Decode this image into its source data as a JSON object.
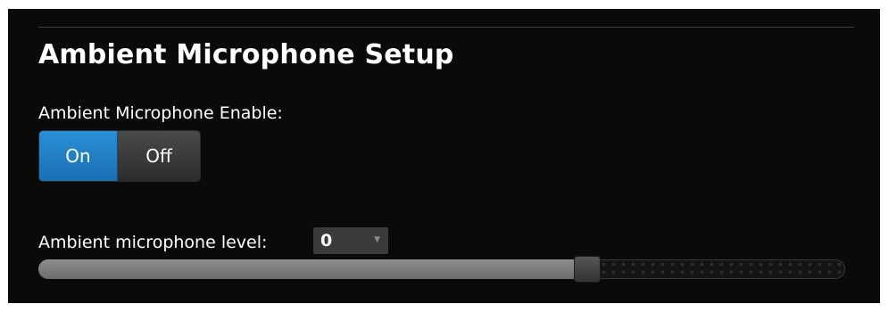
{
  "panel": {
    "title": "Ambient Microphone Setup"
  },
  "enable": {
    "label": "Ambient Microphone Enable:",
    "on_label": "On",
    "off_label": "Off",
    "selected": "On",
    "active_color": "#1f7fc6"
  },
  "level": {
    "label": "Ambient microphone level:",
    "selected_value": "0",
    "slider_fraction": 0.68
  }
}
